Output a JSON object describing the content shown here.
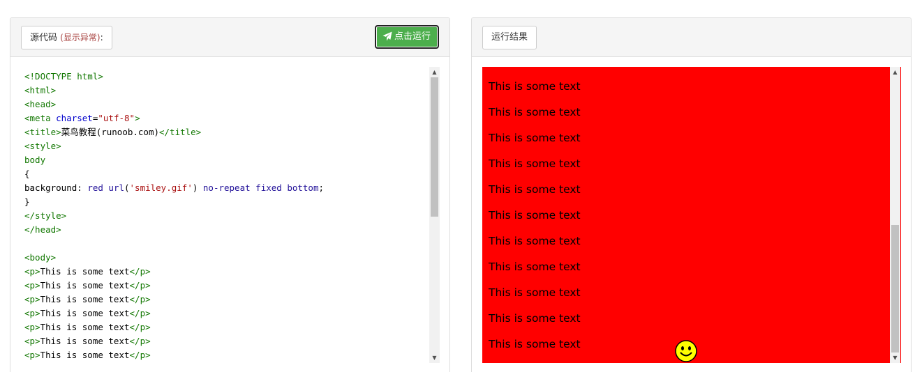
{
  "source_panel": {
    "header_label": "源代码",
    "header_note": "(显示异常)",
    "header_suffix": ":",
    "run_button_label": "点击运行",
    "run_icon": "paper-plane-icon",
    "code_lines": [
      [
        {
          "t": "tag",
          "v": "<!DOCTYPE html>"
        }
      ],
      [
        {
          "t": "tag",
          "v": "<html>"
        }
      ],
      [
        {
          "t": "tag",
          "v": "<head>"
        }
      ],
      [
        {
          "t": "tag",
          "v": "<meta "
        },
        {
          "t": "attr",
          "v": "charset"
        },
        {
          "t": "text",
          "v": "="
        },
        {
          "t": "str",
          "v": "\"utf-8\""
        },
        {
          "t": "tag",
          "v": ">"
        }
      ],
      [
        {
          "t": "tag",
          "v": "<title>"
        },
        {
          "t": "text",
          "v": "菜鸟教程(runoob.com)"
        },
        {
          "t": "tag",
          "v": "</title>"
        }
      ],
      [
        {
          "t": "tag",
          "v": "<style>"
        }
      ],
      [
        {
          "t": "sel",
          "v": "body"
        }
      ],
      [
        {
          "t": "text",
          "v": "{"
        }
      ],
      [
        {
          "t": "prop",
          "v": "background: "
        },
        {
          "t": "kw",
          "v": "red url"
        },
        {
          "t": "text",
          "v": "("
        },
        {
          "t": "str",
          "v": "'smiley.gif'"
        },
        {
          "t": "text",
          "v": ") "
        },
        {
          "t": "kw",
          "v": "no-repeat fixed bottom"
        },
        {
          "t": "text",
          "v": ";"
        }
      ],
      [
        {
          "t": "text",
          "v": "}"
        }
      ],
      [
        {
          "t": "tag",
          "v": "</style>"
        }
      ],
      [
        {
          "t": "tag",
          "v": "</head>"
        }
      ],
      [],
      [
        {
          "t": "tag",
          "v": "<body>"
        }
      ],
      [
        {
          "t": "tag",
          "v": "<p>"
        },
        {
          "t": "text",
          "v": "This is some text"
        },
        {
          "t": "tag",
          "v": "</p>"
        }
      ],
      [
        {
          "t": "tag",
          "v": "<p>"
        },
        {
          "t": "text",
          "v": "This is some text"
        },
        {
          "t": "tag",
          "v": "</p>"
        }
      ],
      [
        {
          "t": "tag",
          "v": "<p>"
        },
        {
          "t": "text",
          "v": "This is some text"
        },
        {
          "t": "tag",
          "v": "</p>"
        }
      ],
      [
        {
          "t": "tag",
          "v": "<p>"
        },
        {
          "t": "text",
          "v": "This is some text"
        },
        {
          "t": "tag",
          "v": "</p>"
        }
      ],
      [
        {
          "t": "tag",
          "v": "<p>"
        },
        {
          "t": "text",
          "v": "This is some text"
        },
        {
          "t": "tag",
          "v": "</p>"
        }
      ],
      [
        {
          "t": "tag",
          "v": "<p>"
        },
        {
          "t": "text",
          "v": "This is some text"
        },
        {
          "t": "tag",
          "v": "</p>"
        }
      ],
      [
        {
          "t": "tag",
          "v": "<p>"
        },
        {
          "t": "text",
          "v": "This is some text"
        },
        {
          "t": "tag",
          "v": "</p>"
        }
      ]
    ],
    "scroll_fraction": 0.0
  },
  "result_panel": {
    "header_label": "运行结果",
    "paragraphs": [
      "This is some text",
      "This is some text",
      "This is some text",
      "This is some text",
      "This is some text",
      "This is some text",
      "This is some text",
      "This is some text",
      "This is some text",
      "This is some text",
      "This is some text"
    ],
    "background_color": "#ff0000",
    "decoration_icon": "smiley-icon",
    "scroll_fraction": 1.0
  },
  "colors": {
    "run_button": "#4cae4c",
    "header_note": "#a94442",
    "code_tag": "#117700",
    "code_attr": "#0000cc",
    "code_string": "#aa1111",
    "code_keyword": "#221199"
  }
}
